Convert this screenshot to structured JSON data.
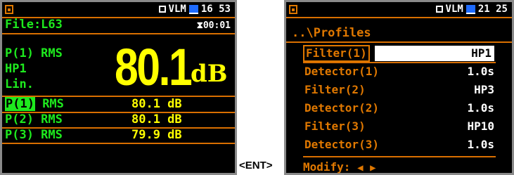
{
  "left": {
    "status_right": "16 53",
    "status_vlm": "VLM",
    "file_label": "File:L63",
    "elapsed": "⧗00:01",
    "p1_line1": "P(1) RMS",
    "p1_line2": "HP1",
    "p1_line3": "Lin.",
    "big_value": "80.1",
    "big_unit": "dB",
    "rows": [
      {
        "name_hl": "P(1)",
        "name_rest": " RMS",
        "value": "80.1 dB"
      },
      {
        "name": "P(2) RMS",
        "value": "80.1 dB"
      },
      {
        "name": "P(3) RMS",
        "value": "79.9 dB"
      }
    ]
  },
  "right": {
    "status_right": "21 25",
    "status_vlm": "VLM",
    "title": "..\\Profiles",
    "items": [
      {
        "label": "Filter(1)",
        "value": "HP1"
      },
      {
        "label": "Detector(1)",
        "value": "1.0s"
      },
      {
        "label": "Filter(2)",
        "value": "HP3"
      },
      {
        "label": "Detector(2)",
        "value": "1.0s"
      },
      {
        "label": "Filter(3)",
        "value": "HP10"
      },
      {
        "label": "Detector(3)",
        "value": "1.0s"
      }
    ],
    "modify_label": "Modify:",
    "arrow_left": "◀",
    "arrow_right": "▶"
  },
  "ent_label": "<ENT>",
  "colors": {
    "orange": "#e07800",
    "green": "#1eea1e",
    "yellow": "#ffff00",
    "blue": "#1e6bff"
  },
  "icons": [
    "battery-icon",
    "vlm-box-icon",
    "memory-icon",
    "hourglass-icon",
    "arrow-left-icon",
    "arrow-right-icon"
  ]
}
